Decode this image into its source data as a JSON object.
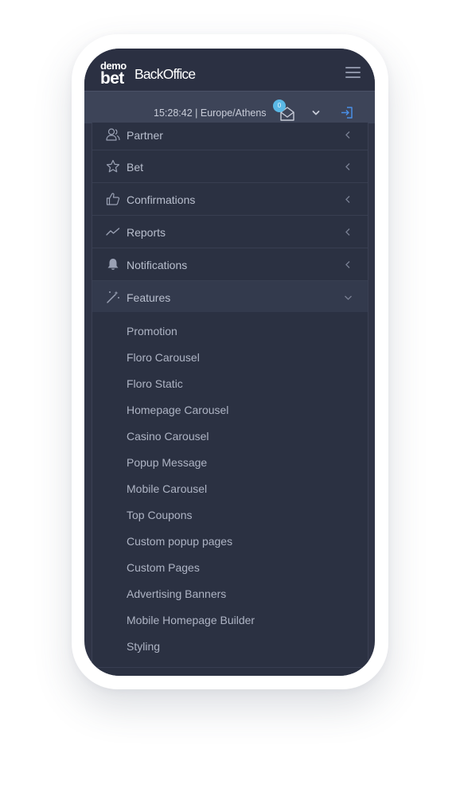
{
  "app": {
    "logo_demo": "demo",
    "logo_bet": "bet",
    "logo_name": "BackOffice"
  },
  "topbar": {
    "clock": "15:28:42 | Europe/Athens",
    "mail_count": "0"
  },
  "menu": {
    "items": [
      {
        "label": "Partner",
        "icon": "partner-icon"
      },
      {
        "label": "Bet",
        "icon": "star-icon"
      },
      {
        "label": "Confirmations",
        "icon": "thumbs-up-icon"
      },
      {
        "label": "Reports",
        "icon": "chart-line-icon"
      },
      {
        "label": "Notifications",
        "icon": "bell-icon"
      },
      {
        "label": "Features",
        "icon": "magic-wand-icon",
        "expanded": true
      }
    ],
    "features_submenu": [
      "Promotion",
      "Floro Carousel",
      "Floro Static",
      "Homepage Carousel",
      "Casino Carousel",
      "Popup Message",
      "Mobile Carousel",
      "Top Coupons",
      "Custom popup pages",
      "Custom Pages",
      "Advertising Banners",
      "Mobile Homepage Builder",
      "Styling"
    ]
  },
  "colors": {
    "header": "#2b3042",
    "topbar": "#3d4458",
    "sidebar": "#2b3142",
    "badge": "#5ab8e6"
  }
}
